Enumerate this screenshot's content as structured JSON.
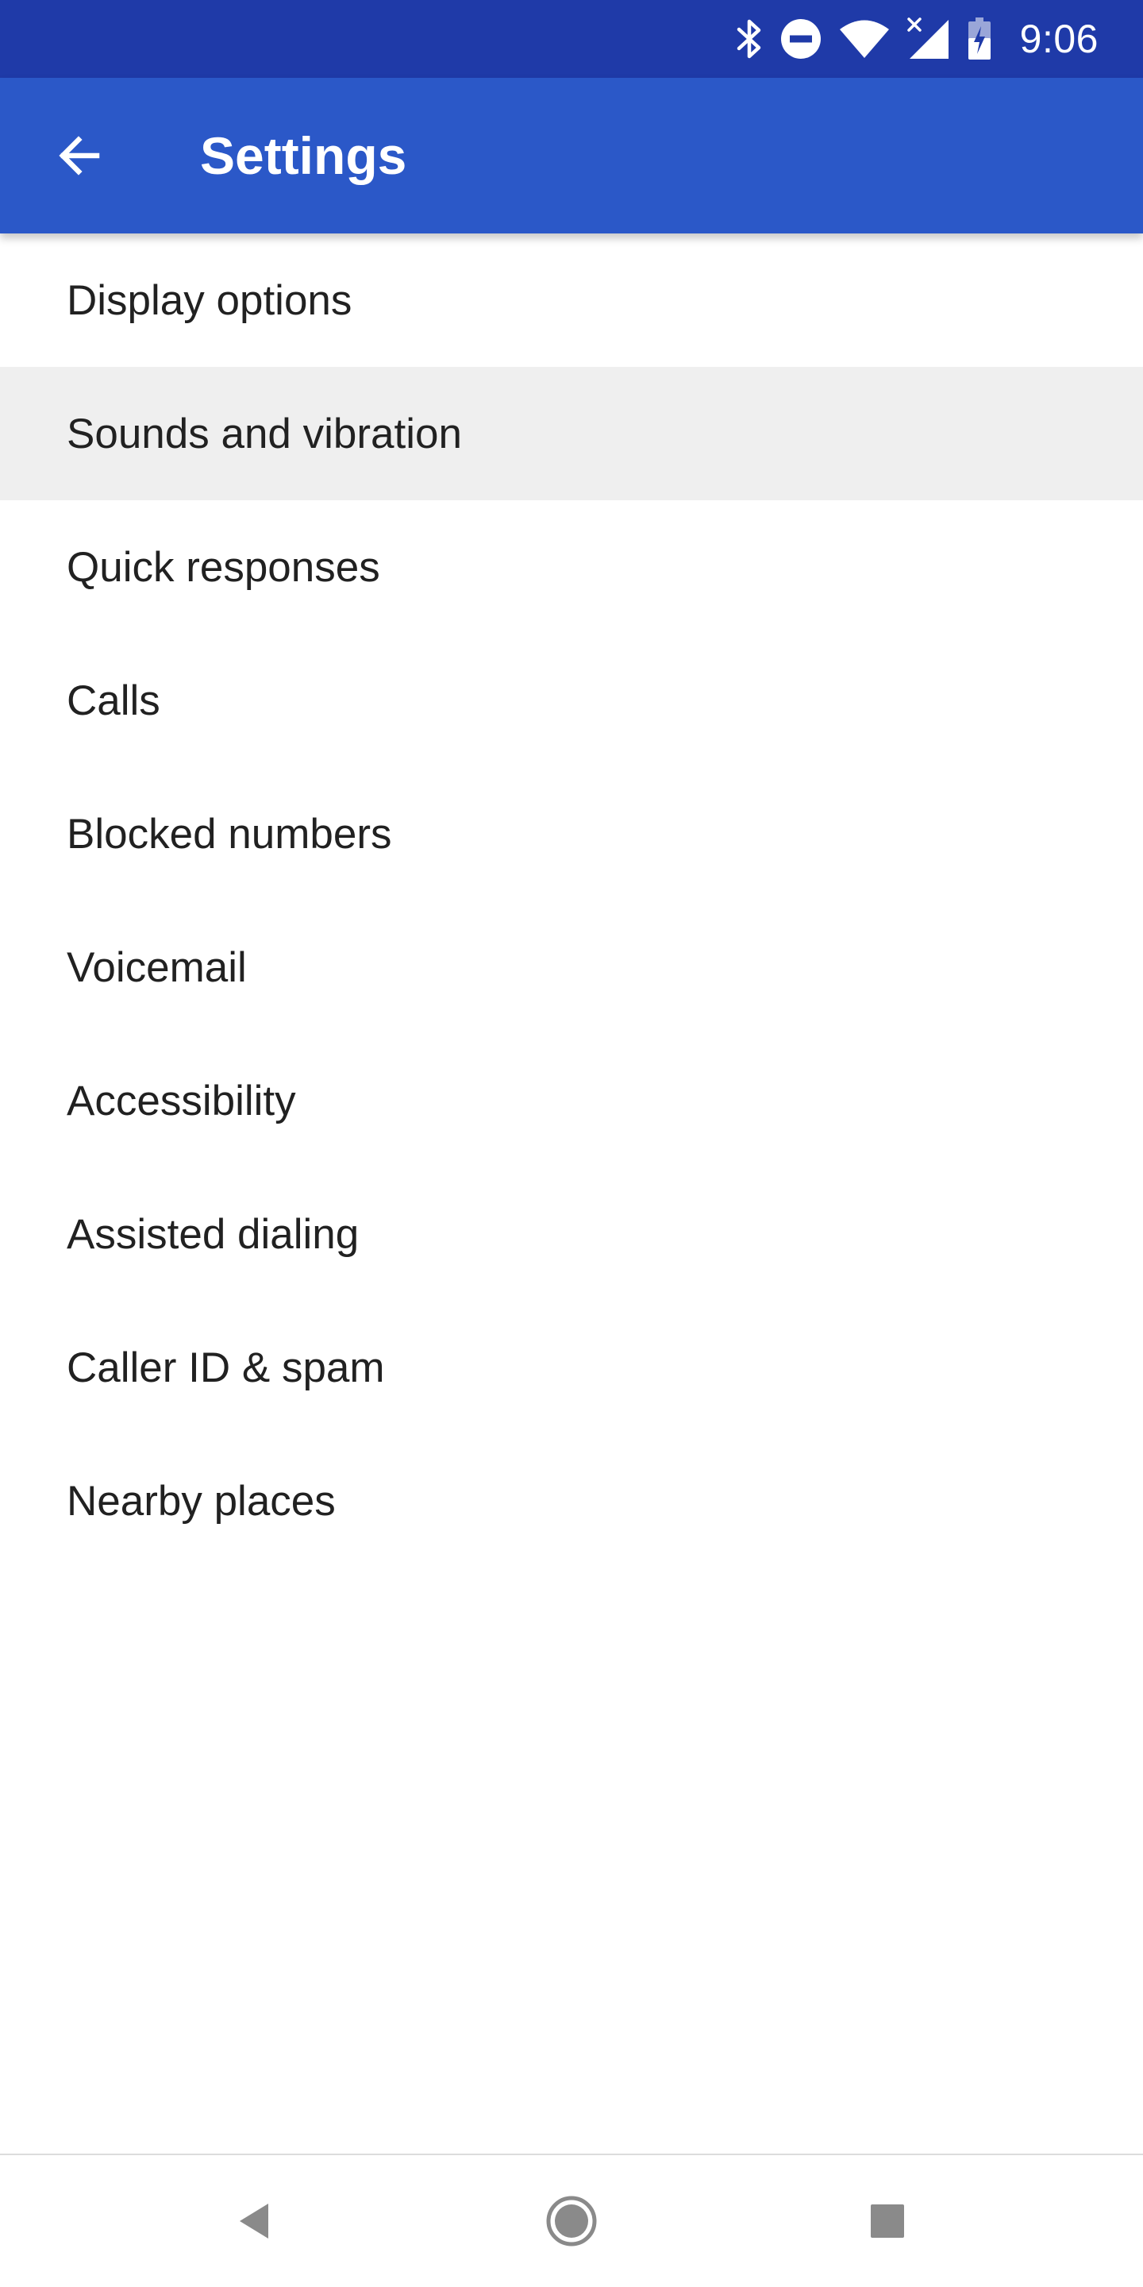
{
  "status_bar": {
    "time": "9:06",
    "icons": [
      "bluetooth-icon",
      "do-not-disturb-icon",
      "wifi-icon",
      "cell-signal-no-data-icon",
      "battery-charging-icon"
    ],
    "background_color": "#1f3aa8"
  },
  "app_bar": {
    "title": "Settings",
    "back_icon": "arrow-back-icon",
    "background_color": "#2b58c8"
  },
  "settings": {
    "highlighted_item": "Sounds and vibration",
    "items": [
      {
        "label": "Display options"
      },
      {
        "label": "Sounds and vibration"
      },
      {
        "label": "Quick responses"
      },
      {
        "label": "Calls"
      },
      {
        "label": "Blocked numbers"
      },
      {
        "label": "Voicemail"
      },
      {
        "label": "Accessibility"
      },
      {
        "label": "Assisted dialing"
      },
      {
        "label": "Caller ID & spam"
      },
      {
        "label": "Nearby places"
      }
    ]
  },
  "nav_bar": {
    "buttons": [
      "back-triangle-icon",
      "home-circle-icon",
      "recents-square-icon"
    ]
  }
}
